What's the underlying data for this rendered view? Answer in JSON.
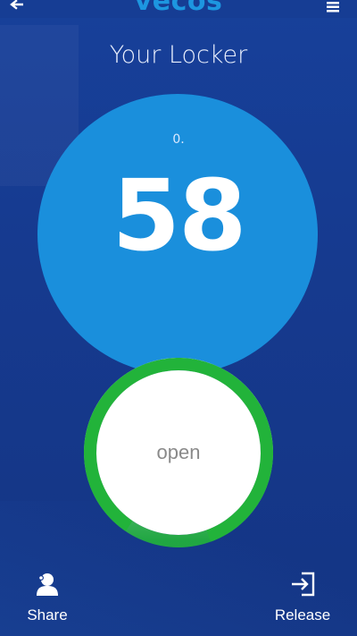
{
  "header": {
    "brand": "vecos",
    "back_icon": "back-arrow-icon",
    "menu_icon": "hamburger-menu-icon"
  },
  "page": {
    "title": "Your Locker"
  },
  "locker": {
    "prefix": "0.",
    "number": "58",
    "circle_color": "#1a8fdc"
  },
  "action": {
    "label": "open",
    "ring_color": "#22b33a",
    "ring_progress": 0.85
  },
  "bottom_nav": {
    "share": {
      "label": "Share",
      "icon": "share-person-icon"
    },
    "release": {
      "label": "Release",
      "icon": "exit-door-icon"
    }
  },
  "colors": {
    "background": "#17409a",
    "brand": "#1d96e0"
  }
}
